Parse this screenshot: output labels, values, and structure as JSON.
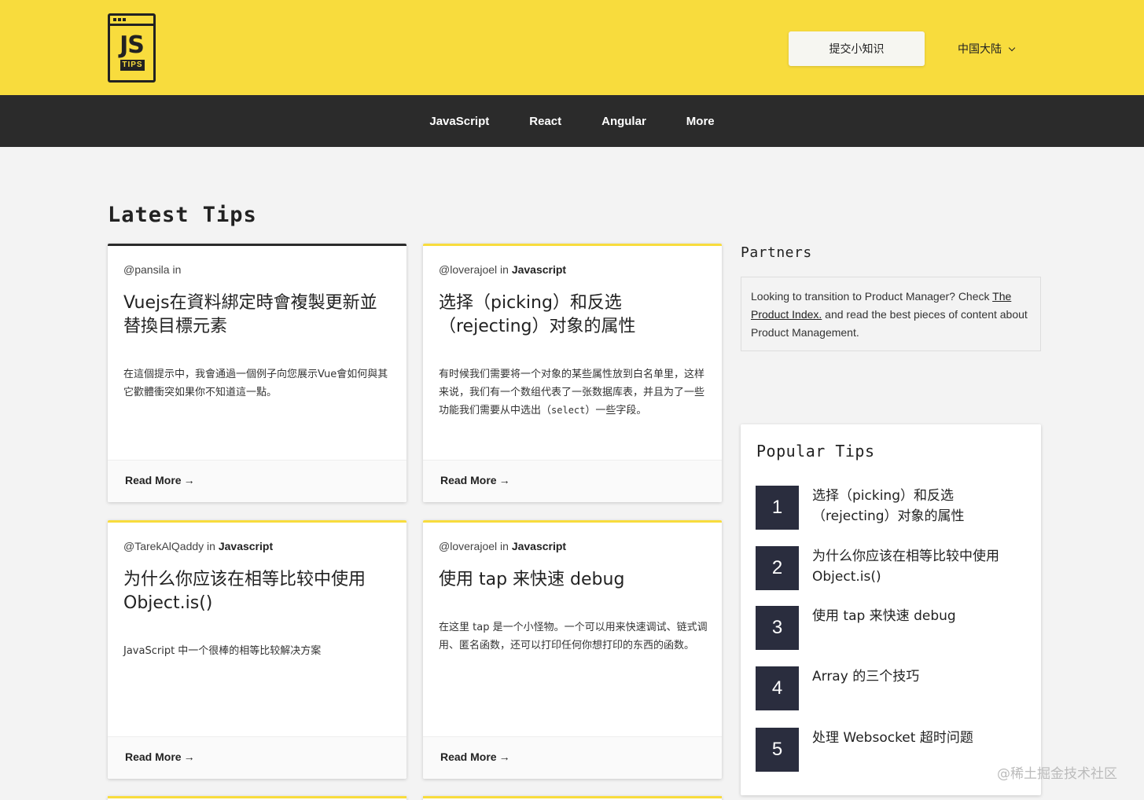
{
  "header": {
    "logo_text": "JS",
    "logo_sub": "TIPS",
    "submit_label": "提交小知识",
    "language": "中国大陆"
  },
  "nav": {
    "items": [
      {
        "label": "JavaScript"
      },
      {
        "label": "React"
      },
      {
        "label": "Angular"
      },
      {
        "label": "More"
      }
    ]
  },
  "main": {
    "section_title": "Latest Tips",
    "read_more_label": "Read More",
    "cards": [
      {
        "author": "@pansila",
        "in_label": "in",
        "category": "",
        "title": "Vuejs在資料綁定時會複製更新並替換目標元素",
        "description": "在這個提示中，我會通過一個例子向您展示Vue會如何與其它歡體衝突如果你不知道這一點。"
      },
      {
        "author": "@loverajoel",
        "in_label": "in",
        "category": "Javascript",
        "title": "选择（picking）和反选（rejecting）对象的属性",
        "description": "有时候我们需要将一个对象的某些属性放到白名单里，这样来说，我们有一个数组代表了一张数据库表，并且为了一些功能我们需要从中选出（",
        "description_code": "select",
        "description_tail": "）一些字段。"
      },
      {
        "author": "@TarekAlQaddy",
        "in_label": "in",
        "category": "Javascript",
        "title": "为什么你应该在相等比较中使用 Object.is()",
        "description": "JavaScript 中一个很棒的相等比较解决方案"
      },
      {
        "author": "@loverajoel",
        "in_label": "in",
        "category": "Javascript",
        "title": "使用 tap 来快速 debug",
        "description": "在这里 tap 是一个小怪物。一个可以用来快速调试、链式调用、匿名函数，还可以打印任何你想打印的东西的函数。"
      }
    ]
  },
  "sidebar": {
    "partners_title": "Partners",
    "partners_text_before": "Looking to transition to Product Manager? Check ",
    "partners_link": "The Product Index.",
    "partners_text_after": " and read the best pieces of content about Product Management.",
    "popular_title": "Popular Tips",
    "popular": [
      {
        "num": "1",
        "text": "选择（picking）和反选（rejecting）对象的属性"
      },
      {
        "num": "2",
        "text": "为什么你应该在相等比较中使用 Object.is()"
      },
      {
        "num": "3",
        "text": "使用 tap 来快速 debug"
      },
      {
        "num": "4",
        "text": "Array 的三个技巧"
      },
      {
        "num": "5",
        "text": "处理 Websocket 超时问题"
      }
    ]
  },
  "watermark": "@稀土掘金技术社区"
}
